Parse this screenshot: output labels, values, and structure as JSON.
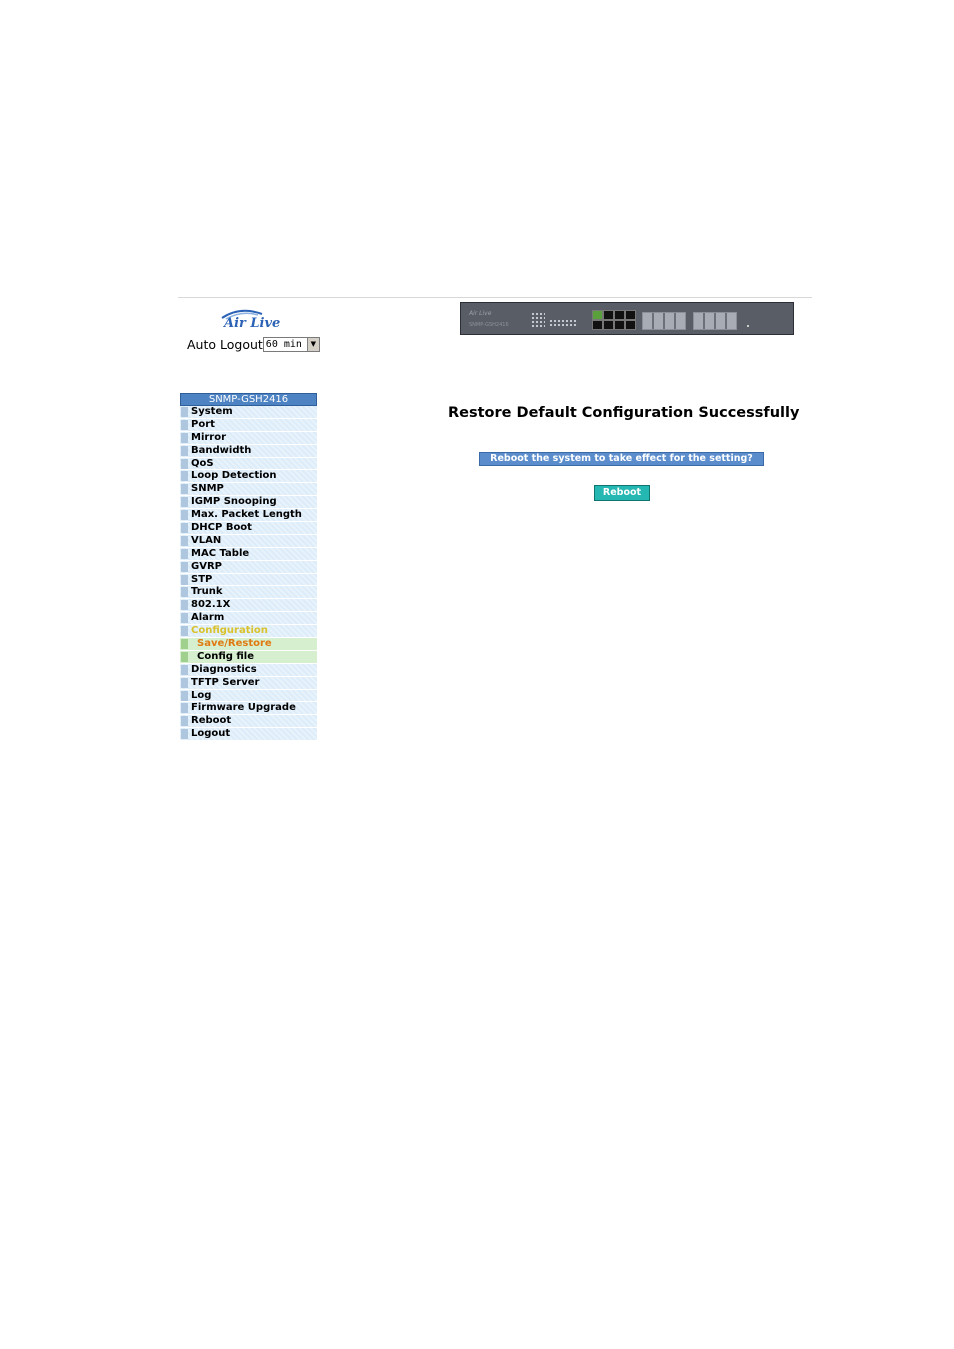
{
  "header": {
    "logo_text": "Air Live",
    "auto_logout_label": "Auto Logout",
    "auto_logout_value": "60 min",
    "switch_brand": "Air Live",
    "switch_model": "SNMP-GSH2416"
  },
  "sidebar": {
    "title": "SNMP-GSH2416",
    "items": [
      {
        "label": "System"
      },
      {
        "label": "Port"
      },
      {
        "label": "Mirror"
      },
      {
        "label": "Bandwidth"
      },
      {
        "label": "QoS"
      },
      {
        "label": "Loop Detection"
      },
      {
        "label": "SNMP"
      },
      {
        "label": "IGMP Snooping"
      },
      {
        "label": "Max. Packet Length"
      },
      {
        "label": "DHCP Boot"
      },
      {
        "label": "VLAN"
      },
      {
        "label": "MAC Table"
      },
      {
        "label": "GVRP"
      },
      {
        "label": "STP"
      },
      {
        "label": "Trunk"
      },
      {
        "label": "802.1X"
      },
      {
        "label": "Alarm"
      },
      {
        "label": "Configuration"
      },
      {
        "label": "Save/Restore"
      },
      {
        "label": "Config file"
      },
      {
        "label": "Diagnostics"
      },
      {
        "label": "TFTP Server"
      },
      {
        "label": "Log"
      },
      {
        "label": "Firmware Upgrade"
      },
      {
        "label": "Reboot"
      },
      {
        "label": "Logout"
      }
    ]
  },
  "main": {
    "title": "Restore Default Configuration Successfully",
    "prompt": "Reboot the system to take effect for the setting?",
    "reboot_button": "Reboot"
  },
  "colors": {
    "sidebar_title_bg": "#4d82c3",
    "sidebar_item_bg": "#dcecf9",
    "active_section": "#d9c22a",
    "current_sub": "#e07a10",
    "banner_bg": "#5b8ccc",
    "button_bg": "#25b7b2"
  }
}
